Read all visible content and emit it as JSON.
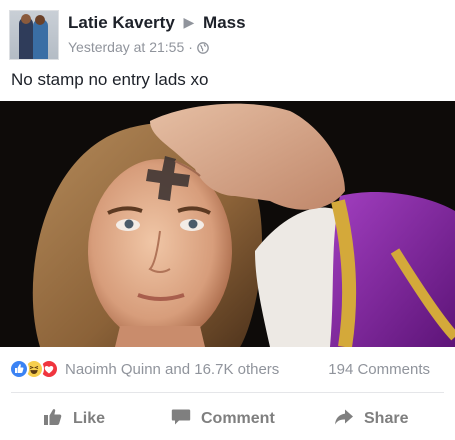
{
  "post": {
    "author": "Latie Kaverty",
    "target": "Mass",
    "timestamp": "Yesterday at 21:55",
    "separator": "·",
    "text": "No stamp no entry lads xo"
  },
  "engagement": {
    "reaction_icons": [
      "like-reaction-icon",
      "haha-reaction-icon",
      "love-reaction-icon"
    ],
    "reactions_text": "Naoimh Quinn and 16.7K others",
    "comments_count": "194 Comments"
  },
  "actions": {
    "like_label": "Like",
    "comment_label": "Comment",
    "share_label": "Share"
  },
  "colors": {
    "like_blue": "#3b83f4",
    "love_red": "#f0353e",
    "haha_yellow": "#f6cf4e",
    "muted_text": "#90949c"
  }
}
